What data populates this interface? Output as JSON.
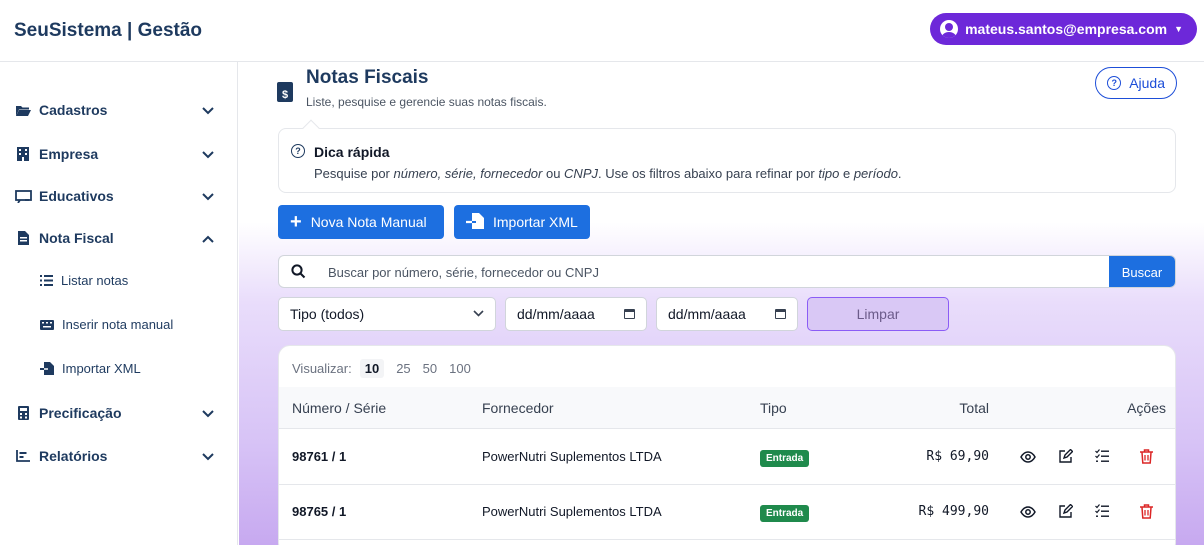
{
  "app": {
    "brand": "SeuSistema | Gestão",
    "user_email": "mateus.santos@empresa.com"
  },
  "sidebar": {
    "items": [
      {
        "label": "Cadastros",
        "icon": "folder-open-icon",
        "expanded": false
      },
      {
        "label": "Empresa",
        "icon": "building-icon",
        "expanded": false
      },
      {
        "label": "Educativos",
        "icon": "chalkboard-icon",
        "expanded": false
      },
      {
        "label": "Nota Fiscal",
        "icon": "file-invoice-icon",
        "expanded": true
      },
      {
        "label": "Precificação",
        "icon": "calculator-icon",
        "expanded": false
      },
      {
        "label": "Relatórios",
        "icon": "chart-bar-icon",
        "expanded": false
      }
    ],
    "nota_fiscal_sub": [
      {
        "label": "Listar notas",
        "icon": "list-icon"
      },
      {
        "label": "Inserir nota manual",
        "icon": "keyboard-icon"
      },
      {
        "label": "Importar XML",
        "icon": "file-import-icon"
      }
    ]
  },
  "page": {
    "title": "Notas Fiscais",
    "subtitle": "Liste, pesquise e gerencie suas notas fiscais.",
    "help_label": "Ajuda"
  },
  "tip": {
    "title": "Dica rápida",
    "text_parts": [
      "Pesquise por ",
      "número, série, fornecedor",
      " ou ",
      "CNPJ",
      ". Use os filtros abaixo para refinar por ",
      "tipo",
      " e ",
      "período",
      "."
    ]
  },
  "actions": {
    "new_manual": "Nova Nota Manual",
    "import_xml": "Importar XML"
  },
  "search": {
    "placeholder": "Buscar por número, série, fornecedor ou CNPJ",
    "button": "Buscar"
  },
  "filters": {
    "tipo": "Tipo (todos)",
    "date_from": "dd/mm/aaaa",
    "date_to": "dd/mm/aaaa",
    "clear": "Limpar"
  },
  "table": {
    "view_label": "Visualizar:",
    "page_sizes": [
      "10",
      "25",
      "50",
      "100"
    ],
    "selected_page_size": "10",
    "headers": {
      "numero": "Número / Série",
      "fornecedor": "Fornecedor",
      "tipo": "Tipo",
      "total": "Total",
      "acoes": "Ações"
    },
    "rows": [
      {
        "numero": "98761 / 1",
        "fornecedor": "PowerNutri Suplementos LTDA",
        "tipo": "Entrada",
        "total": "R$ 69,90"
      },
      {
        "numero": "98765 / 1",
        "fornecedor": "PowerNutri Suplementos LTDA",
        "tipo": "Entrada",
        "total": "R$ 499,90"
      }
    ]
  },
  "colors": {
    "brand_navy": "#1e3a5f",
    "primary_blue": "#1d6fe0",
    "user_purple": "#6d28d9",
    "badge_green": "#1f8a4c",
    "delete_red": "#dc2626"
  }
}
